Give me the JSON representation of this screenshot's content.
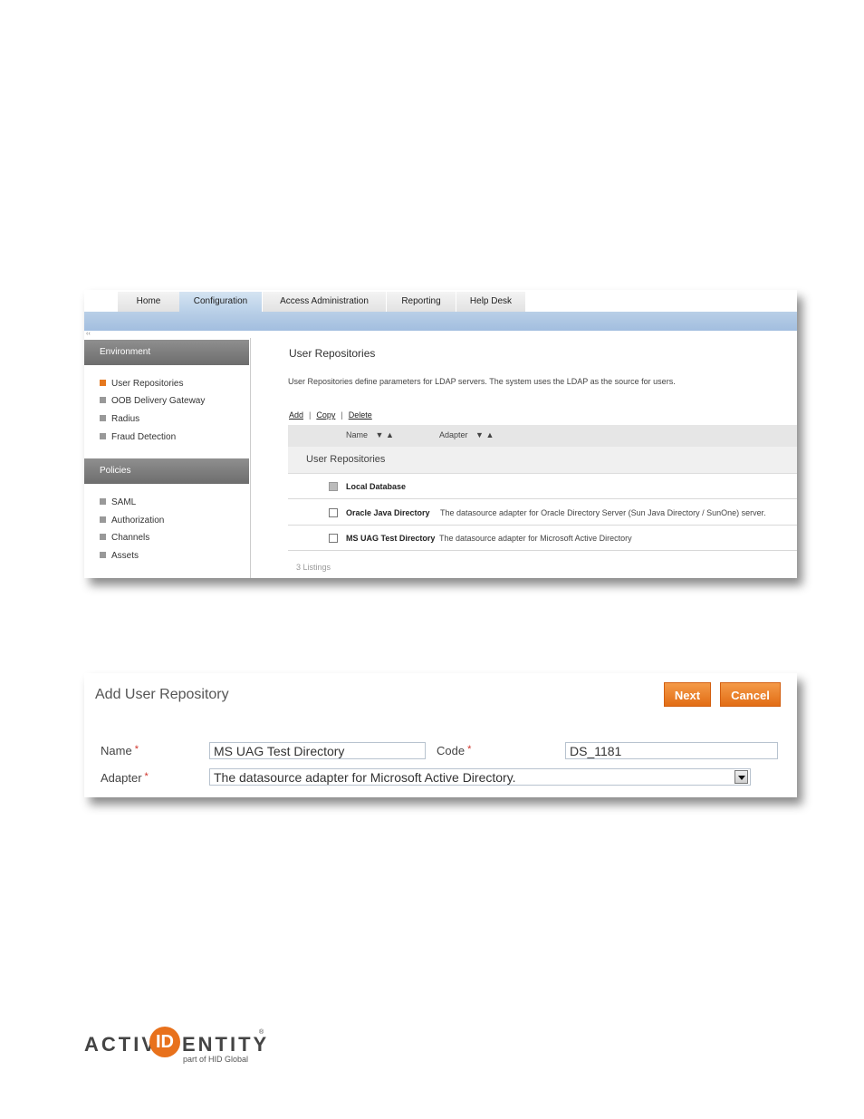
{
  "nav": {
    "tabs": [
      {
        "label": "Home"
      },
      {
        "label": "Configuration"
      },
      {
        "label": "Access Administration"
      },
      {
        "label": "Reporting"
      },
      {
        "label": "Help Desk"
      }
    ],
    "active_tab": "Configuration",
    "collapse_glyph": "‹‹"
  },
  "sidebar": {
    "environment_header": "Environment",
    "environment_items": [
      {
        "label": "User Repositories",
        "icon": "arrow-right-icon"
      },
      {
        "label": "OOB Delivery Gateway",
        "icon": "arrow-right-icon"
      },
      {
        "label": "Radius",
        "icon": "plus-icon"
      },
      {
        "label": "Fraud Detection",
        "icon": "arrow-right-icon"
      }
    ],
    "policies_header": "Policies",
    "policies_items": [
      {
        "label": "SAML",
        "icon": "plus-icon"
      },
      {
        "label": "Authorization",
        "icon": "plus-icon"
      },
      {
        "label": "Channels",
        "icon": "plus-icon"
      },
      {
        "label": "Assets",
        "icon": "arrow-right-icon"
      }
    ]
  },
  "main": {
    "title": "User Repositories",
    "description": "User Repositories define parameters for LDAP servers. The system uses the LDAP as the source for users.",
    "actions": {
      "add": "Add",
      "copy": "Copy",
      "delete": "Delete"
    },
    "columns": {
      "name": "Name",
      "adapter": "Adapter"
    },
    "group_label": "User Repositories",
    "rows": [
      {
        "name": "Local Database",
        "adapter": ""
      },
      {
        "name": "Oracle Java Directory",
        "adapter": "The datasource adapter for Oracle Directory Server (Sun Java Directory / SunOne) server."
      },
      {
        "name": "MS UAG Test Directory",
        "adapter": "The datasource adapter for Microsoft Active Directory"
      }
    ],
    "listings": "3 Listings"
  },
  "form": {
    "title": "Add User Repository",
    "next_label": "Next",
    "cancel_label": "Cancel",
    "name_label": "Name",
    "name_value": "MS UAG Test Directory",
    "code_label": "Code",
    "code_value": "DS_1181",
    "adapter_label": "Adapter",
    "adapter_value": "The datasource adapter for Microsoft Active Directory.",
    "required_marker": "*"
  },
  "logo": {
    "left": "ACTIV",
    "circle": "ID",
    "right": "ENTITY",
    "registered": "®",
    "tagline": "part of HID Global"
  },
  "colors": {
    "accent_orange": "#e8711c",
    "nav_blue": "#a2bedf",
    "sidebar_header": "#7a7a7a"
  }
}
